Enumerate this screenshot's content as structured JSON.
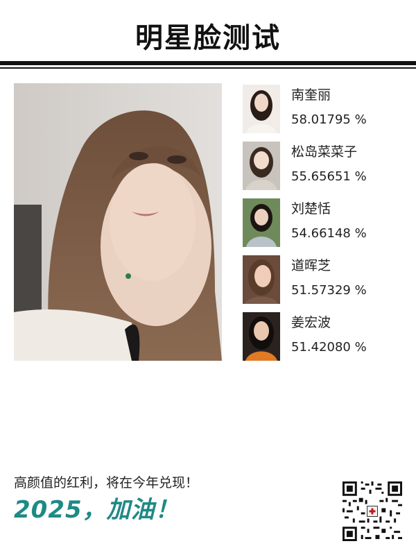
{
  "header": {
    "title": "明星脸测试"
  },
  "results": [
    {
      "name": "南奎丽",
      "score": "58.01795 %",
      "thumb_bg": "#f1ece8",
      "hair": "#2a1d18",
      "skin": "#f0d8c8",
      "top": "#f7f3ef"
    },
    {
      "name": "松岛菜菜子",
      "score": "55.65651 %",
      "thumb_bg": "#c9c3bd",
      "hair": "#3a2a22",
      "skin": "#f2dccd",
      "top": "#d8d2ca"
    },
    {
      "name": "刘楚恬",
      "score": "54.66148 %",
      "thumb_bg": "#6f8a5a",
      "hair": "#1b1512",
      "skin": "#ecd0bf",
      "top": "#b9c2c8"
    },
    {
      "name": "道晖芝",
      "score": "51.57329 %",
      "thumb_bg": "#6b4b3c",
      "hair": "#5a3c2a",
      "skin": "#f0cdb8",
      "top": "#7a5a48"
    },
    {
      "name": "姜宏波",
      "score": "51.42080 %",
      "thumb_bg": "#2b2220",
      "hair": "#120e0d",
      "skin": "#e9c6ae",
      "top": "#e07a24"
    }
  ],
  "footer": {
    "line1": "高颜值的红利，将在今年兑现！",
    "line2": "2025，加油！"
  },
  "colors": {
    "accent": "#1e8a86",
    "rule": "#111111"
  },
  "icons": {
    "qr": "qr-code-icon"
  }
}
